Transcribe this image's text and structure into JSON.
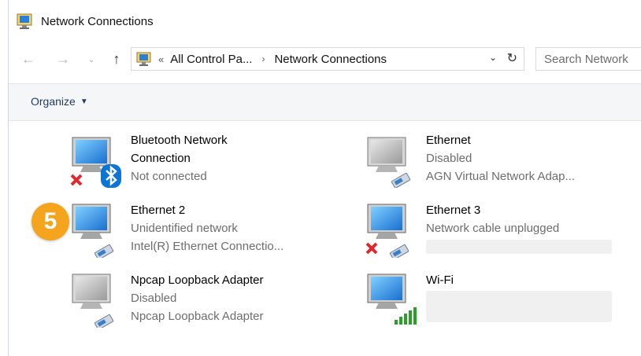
{
  "window": {
    "title": "Network Connections",
    "icon": "network-connections-icon"
  },
  "nav": {
    "back_icon": "arrow-left-icon",
    "forward_icon": "arrow-right-icon",
    "recent_icon": "chevron-down-icon",
    "up_icon": "arrow-up-icon"
  },
  "address": {
    "overflow": "«",
    "crumbs": [
      "All Control Pa...",
      "Network Connections"
    ],
    "separator": "›",
    "dropdown": "⌄",
    "refresh": "↻"
  },
  "search": {
    "placeholder": "Search Network"
  },
  "toolbar": {
    "organize_label": "Organize"
  },
  "badge": {
    "number": "5"
  },
  "connections": [
    {
      "name": "Bluetooth Network",
      "name2": "Connection",
      "status": "Not connected",
      "detail": "",
      "icon": "bluetooth-network-icon",
      "overlays": [
        "red-x-icon",
        "bluetooth-icon"
      ]
    },
    {
      "name": "Ethernet",
      "status": "Disabled",
      "detail": "AGN Virtual Network Adap...",
      "icon": "ethernet-disabled-icon",
      "overlays": [
        "network-cable-icon"
      ]
    },
    {
      "name": "Ethernet 2",
      "status": "Unidentified network",
      "detail": "Intel(R) Ethernet Connectio...",
      "icon": "ethernet-icon",
      "overlays": [
        "network-cable-icon"
      ]
    },
    {
      "name": "Ethernet 3",
      "status": "Network cable unplugged",
      "detail": "",
      "icon": "ethernet-icon",
      "overlays": [
        "red-x-icon",
        "network-cable-icon"
      ]
    },
    {
      "name": "Npcap Loopback Adapter",
      "status": "Disabled",
      "detail": "Npcap Loopback Adapter",
      "icon": "ethernet-disabled-icon",
      "overlays": [
        "network-cable-icon"
      ]
    },
    {
      "name": "Wi-Fi",
      "status": "",
      "detail": "",
      "icon": "wifi-icon",
      "overlays": [
        "signal-bars-icon"
      ]
    }
  ],
  "colors": {
    "accent": "#1e3a5f",
    "badge": "#f4a41d",
    "muted_text": "#6d6d6d",
    "error": "#e3262b",
    "bluetooth": "#0b75d6",
    "signal": "#2aa02a"
  }
}
